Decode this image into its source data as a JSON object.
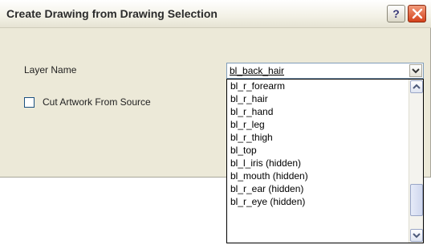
{
  "dialog": {
    "title": "Create Drawing from Drawing Selection",
    "help_label": "?",
    "layer_name_label": "Layer Name",
    "layer_selected": "bl_back_hair",
    "cut_artwork_label": "Cut Artwork From Source",
    "cut_artwork_checked": false
  },
  "dropdown": {
    "items": [
      "bl_r_forearm",
      "bl_r_hair",
      "bl_r_hand",
      "bl_r_leg",
      "bl_r_thigh",
      "bl_top",
      "bl_l_iris (hidden)",
      "bl_mouth (hidden)",
      "bl_r_ear (hidden)",
      "bl_r_eye (hidden)"
    ]
  },
  "colors": {
    "dialog_bg": "#ece9d8",
    "close_button": "#d4421c",
    "scrollbar_button": "#dfe4f2"
  },
  "icons": [
    "help-icon",
    "close-icon",
    "chevron-down-icon",
    "scroll-up-icon",
    "scroll-down-icon"
  ]
}
